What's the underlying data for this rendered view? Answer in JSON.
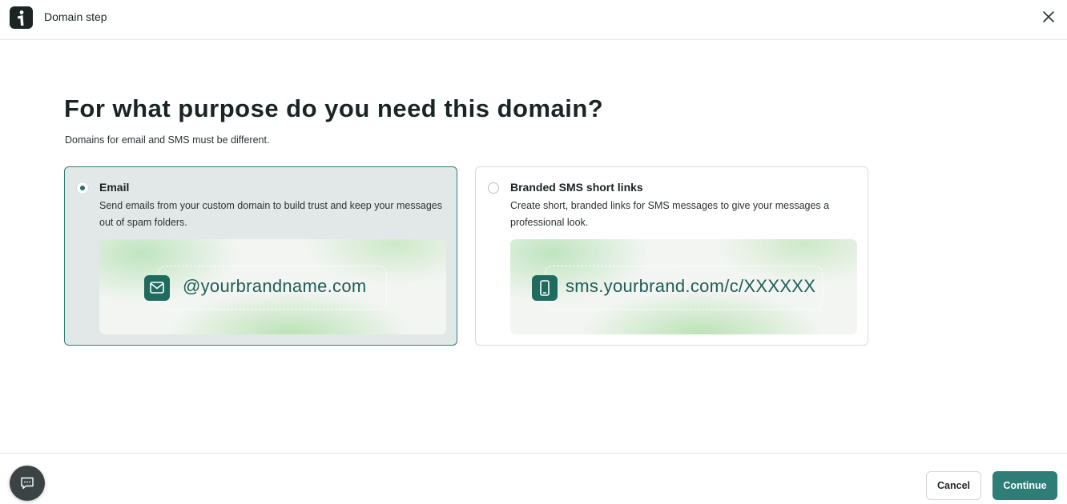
{
  "header": {
    "title": "Domain step",
    "logo_icon": "brand-logo-icon",
    "close_icon": "close-icon"
  },
  "main": {
    "heading": "For what purpose do you need this domain?",
    "subheading": "Domains for email and SMS must be different.",
    "options": [
      {
        "title": "Email",
        "description": "Send emails from your custom domain to build trust and keep your messages out of spam folders.",
        "preview_text": "@yourbrandname.com",
        "icon": "envelope-icon",
        "selected": true
      },
      {
        "title": "Branded SMS short links",
        "description": "Create short, branded links for SMS messages to give your messages a professional look.",
        "preview_text": "sms.yourbrand.com/c/XXXXXX",
        "icon": "phone-icon",
        "selected": false
      }
    ]
  },
  "footer": {
    "chat_icon": "chat-icon",
    "cancel_label": "Cancel",
    "continue_label": "Continue"
  },
  "colors": {
    "accent": "#2e7d77",
    "selected_card_bg": "#e2e8e8",
    "preview_text": "#1f5d57"
  }
}
